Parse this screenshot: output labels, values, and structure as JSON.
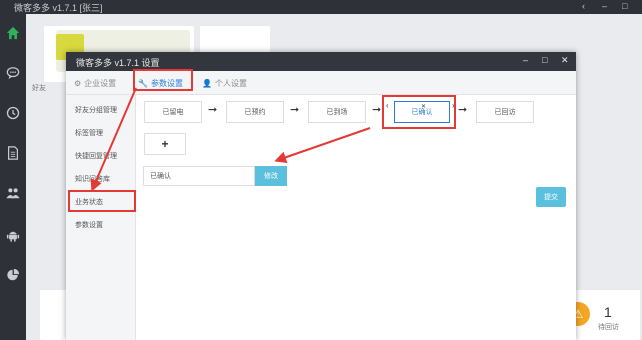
{
  "app": {
    "title": "微客多多 v1.7.1 [张三]",
    "window_controls": [
      "‹",
      "–",
      "□"
    ]
  },
  "sidebar": {
    "icons": [
      "home-icon",
      "chat-icon",
      "clock-icon",
      "document-icon",
      "users-icon",
      "android-icon",
      "pie-chart-icon"
    ],
    "accent": "#2fb35a"
  },
  "background": {
    "left_label": "好友",
    "stat_value": "1",
    "stat_label": "待回访",
    "warn_glyph": "⚠"
  },
  "dialog": {
    "title": "微客多多 v1.7.1 设置",
    "controls": [
      "–",
      "□",
      "✕"
    ],
    "tabs": [
      {
        "icon": "gear-icon",
        "label": "企业设置",
        "active": false
      },
      {
        "icon": "wrench-icon",
        "label": "参数设置",
        "active": true
      },
      {
        "icon": "user-icon",
        "label": "个人设置",
        "active": false
      }
    ],
    "nav": [
      "好友分组管理",
      "标签管理",
      "快捷回复管理",
      "知识问答库",
      "业务状态",
      "参数设置"
    ],
    "steps": [
      "已留电",
      "已预约",
      "已到场",
      "已确认",
      "已回访"
    ],
    "step_arrow": "➞",
    "selected_step_index": 3,
    "add_glyph": "+",
    "input_value": "已确认",
    "edit_label": "修改",
    "submit_label": "提交"
  },
  "colors": {
    "accent_blue": "#2a7fd4",
    "button_cyan": "#5bc0de",
    "annotation_red": "#e53935"
  }
}
